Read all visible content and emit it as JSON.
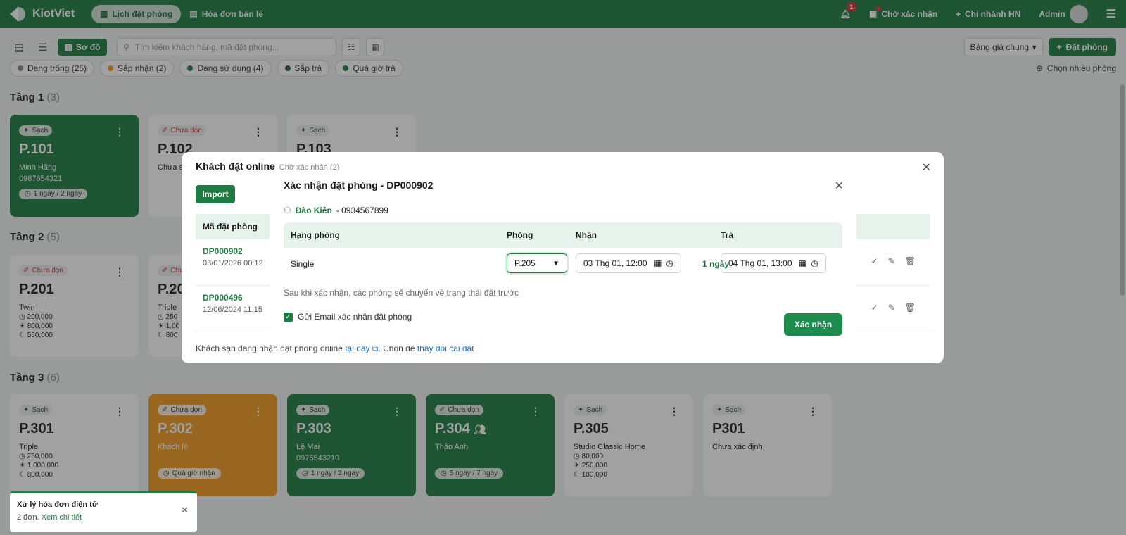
{
  "colors": {
    "brand": "#1e7c43",
    "accent_orange": "#f29c1f"
  },
  "topbar": {
    "brand": "KiotViet",
    "tabs": [
      {
        "label": "Lịch đặt phòng",
        "icon": "calendar-icon"
      },
      {
        "label": "Hóa đơn bán lẻ",
        "icon": "receipt-icon"
      }
    ],
    "notifications_count": "1",
    "pending": "Chờ xác nhận",
    "branch": "Chi nhánh HN",
    "user": "Admin"
  },
  "toolbar": {
    "view_map": "Sơ đồ",
    "search_placeholder": "Tìm kiếm khách hàng, mã đặt phòng...",
    "pricing": "Bảng giá chung",
    "book_button": "Đặt phòng"
  },
  "filters": [
    {
      "label": "Đang trống (25)",
      "color": "#8a8f8c"
    },
    {
      "label": "Sắp nhận (2)",
      "color": "#f29c1f"
    },
    {
      "label": "Đang sử dụng (4)",
      "color": "#1e7c43"
    },
    {
      "label": "Sắp trả",
      "color": "#1e5c3a"
    },
    {
      "label": "Quá giờ trả",
      "color": "#1e7c43"
    }
  ],
  "multi_select": "Chọn nhiều phòng",
  "floors": [
    {
      "name": "Tầng 1",
      "count": "(3)"
    },
    {
      "name": "Tầng 2",
      "count": "(5)"
    },
    {
      "name": "Tầng 3",
      "count": "(6)"
    }
  ],
  "rooms": {
    "p101": {
      "tag": "Sạch",
      "name": "P.101",
      "guest": "Minh Hằng",
      "phone": "0987654321",
      "stay": "1 ngày / 2 ngày"
    },
    "p102": {
      "tag": "Chưa dọn",
      "name": "P.102",
      "sub": "Chưa s"
    },
    "p103": {
      "tag": "Sạch",
      "name": "P.103"
    },
    "p201": {
      "tag": "Chưa dọn",
      "name": "P.201",
      "type": "Twin",
      "p1": "200,000",
      "p2": "800,000",
      "p3": "550,000"
    },
    "p202": {
      "tag": "Chư",
      "name": "P.20",
      "type": "Triple",
      "p1": "250",
      "p2": "1,00",
      "p3": "800"
    },
    "p301": {
      "tag": "Sạch",
      "name": "P.301",
      "type": "Triple",
      "p1": "250,000",
      "p2": "1,000,000",
      "p3": "800,000"
    },
    "p302": {
      "tag": "Chưa dọn",
      "name": "P.302",
      "guest": "Khách lẻ",
      "stay": "Quá giờ nhận"
    },
    "p303": {
      "tag": "Sạch",
      "name": "P.303",
      "guest": "Lệ Mai",
      "phone": "0976543210",
      "stay": "1 ngày / 2 ngày"
    },
    "p304": {
      "tag": "Chưa dọn",
      "name": "P.304",
      "guest": "Thảo Anh",
      "stay": "5 ngày / 7 ngày"
    },
    "p305": {
      "tag": "Sạch",
      "name": "P.305",
      "type": "Studio Classic Home",
      "p1": "80,000",
      "p2": "250,000",
      "p3": "180,000"
    },
    "p301b": {
      "tag": "Sạch",
      "name": "P301",
      "type": "Chưa xác định"
    }
  },
  "online_panel": {
    "title": "Khách đặt online",
    "subtitle": "Chờ xác nhận (2)",
    "import": "Import",
    "col_code": "Mã đặt phòng",
    "rows": [
      {
        "code": "DP000902",
        "date": "03/01/2026 00:12"
      },
      {
        "code": "DP000496",
        "date": "12/06/2024 11:15"
      }
    ],
    "footer_text": "Khách sạn đang nhận đặt phòng online ",
    "footer_link1": "tại đây",
    "footer_mid": ". Chọn để ",
    "footer_link2": "thay đổi cài đặt"
  },
  "modal": {
    "title": "Xác nhận đặt phòng - DP000902",
    "guest_name": "Đào Kiên",
    "guest_phone": "- 0934567899",
    "col_type": "Hạng phòng",
    "col_room": "Phòng",
    "col_checkin": "Nhận",
    "col_checkout": "Trả",
    "room_type": "Single",
    "room": "P.205",
    "checkin": "03 Thg 01, 12:00",
    "duration": "1 ngày",
    "checkout": "04 Thg 01, 13:00",
    "note": "Sau khi xác nhận, các phòng sẽ chuyển về trạng thái đặt trước",
    "email_label": "Gửi Email xác nhận đặt phòng",
    "email_checked": true,
    "confirm": "Xác nhận"
  },
  "toast": {
    "title": "Xử lý hóa đơn điện tử",
    "body": "2 đơn. ",
    "link": "Xem chi tiết"
  }
}
